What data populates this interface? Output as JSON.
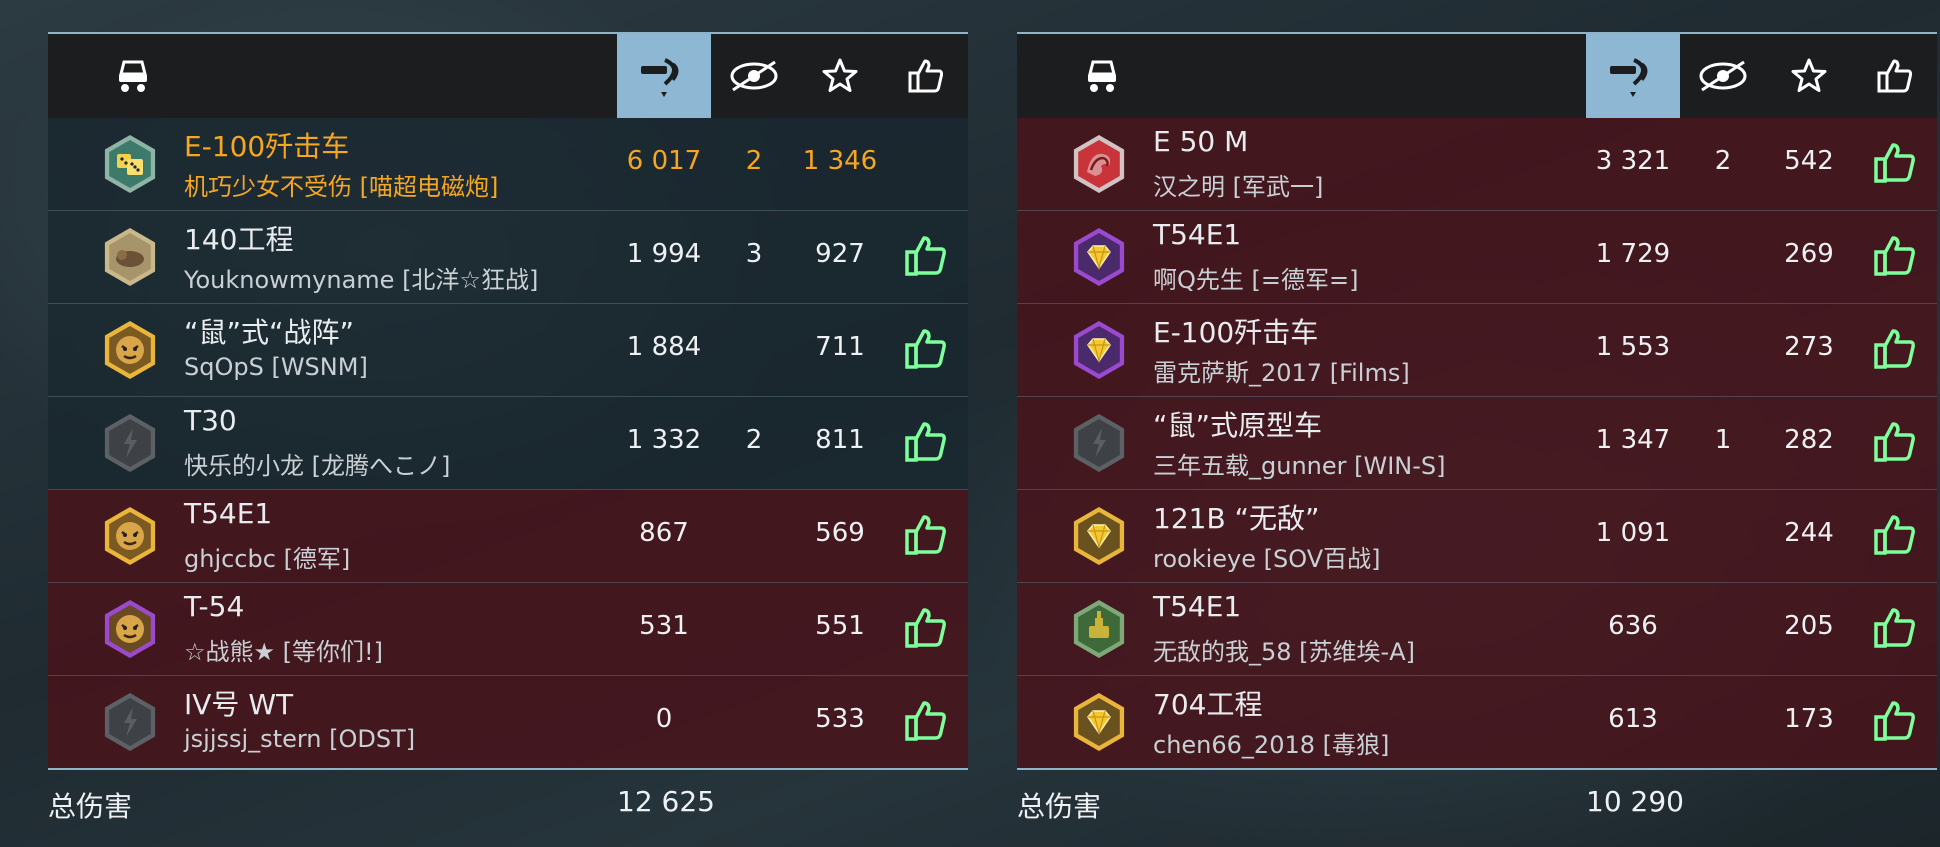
{
  "colors": {
    "highlight": "#f5a623",
    "enemy_row": "#4a121a",
    "ally_row": "#18262e",
    "like_green": "#7dff9c",
    "active_header": "#8db7d3"
  },
  "header_icons": [
    "tank-icon",
    "damage-icon",
    "spotted-icon",
    "experience-star-icon",
    "like-icon"
  ],
  "allies": [
    {
      "tank": "E-100歼击车",
      "player": "机巧少女不受伤 [喵超电磁炮]",
      "damage": "6 017",
      "spotted": "2",
      "xp": "1 346",
      "badge": "dice-emblem",
      "me": true,
      "liked": false
    },
    {
      "tank": "140工程",
      "player": "Youknowmyname [北洋☆狂战]",
      "damage": "1 994",
      "spotted": "3",
      "xp": "927",
      "badge": "bronze-beast-emblem",
      "me": false,
      "liked": true
    },
    {
      "tank": "“鼠”式“战阵”",
      "player": "SqOpS [WSNM]",
      "damage": "1 884",
      "spotted": "",
      "xp": "711",
      "badge": "gold-tiger-emblem",
      "me": false,
      "liked": true
    },
    {
      "tank": "T30",
      "player": "快乐的小龙 [龙腾へこノ]",
      "damage": "1 332",
      "spotted": "2",
      "xp": "811",
      "badge": "grey-lightning-emblem",
      "me": false,
      "liked": true
    },
    {
      "tank": "T54E1",
      "player": "ghjccbc [德军]",
      "damage": "867",
      "spotted": "",
      "xp": "569",
      "badge": "gold-tiger-emblem",
      "me": false,
      "liked": true,
      "dark": true
    },
    {
      "tank": "T-54",
      "player": "☆战熊★ [等你们!]",
      "damage": "531",
      "spotted": "",
      "xp": "551",
      "badge": "purple-tiger-emblem",
      "me": false,
      "liked": true,
      "dark": true
    },
    {
      "tank": "IV号 WT",
      "player": "jsjjssj_stern [ODST]",
      "damage": "0",
      "spotted": "",
      "xp": "533",
      "badge": "grey-lightning-emblem",
      "me": false,
      "liked": true,
      "dark": true
    }
  ],
  "enemies": [
    {
      "tank": "E 50 M",
      "player": "汉之明 [军武一]",
      "damage": "3 321",
      "spotted": "2",
      "xp": "542",
      "badge": "red-dragon-emblem",
      "liked": true
    },
    {
      "tank": "T54E1",
      "player": "啊Q先生 [=德军=]",
      "damage": "1 729",
      "spotted": "",
      "xp": "269",
      "badge": "purple-gem-emblem",
      "liked": true
    },
    {
      "tank": "E-100歼击车",
      "player": "雷克萨斯_2017 [Films]",
      "damage": "1 553",
      "spotted": "",
      "xp": "273",
      "badge": "purple-gem-emblem",
      "liked": true
    },
    {
      "tank": "“鼠”式原型车",
      "player": "三年五载_gunner [WIN-S]",
      "damage": "1 347",
      "spotted": "1",
      "xp": "282",
      "badge": "grey-lightning-emblem",
      "liked": true
    },
    {
      "tank": "121B “无敌”",
      "player": "rookieye [SOV百战]",
      "damage": "1 091",
      "spotted": "",
      "xp": "244",
      "badge": "gold-gem-emblem",
      "liked": true
    },
    {
      "tank": "T54E1",
      "player": "无敌的我_58 [苏维埃-A]",
      "damage": "636",
      "spotted": "",
      "xp": "205",
      "badge": "green-tank-emblem",
      "liked": true
    },
    {
      "tank": "704工程",
      "player": "chen66_2018 [毒狼]",
      "damage": "613",
      "spotted": "",
      "xp": "173",
      "badge": "gold-gem-emblem",
      "liked": true
    }
  ],
  "footer": {
    "label_left": "总伤害",
    "total_left": "12 625",
    "label_right": "总伤害",
    "total_right": "10 290"
  }
}
